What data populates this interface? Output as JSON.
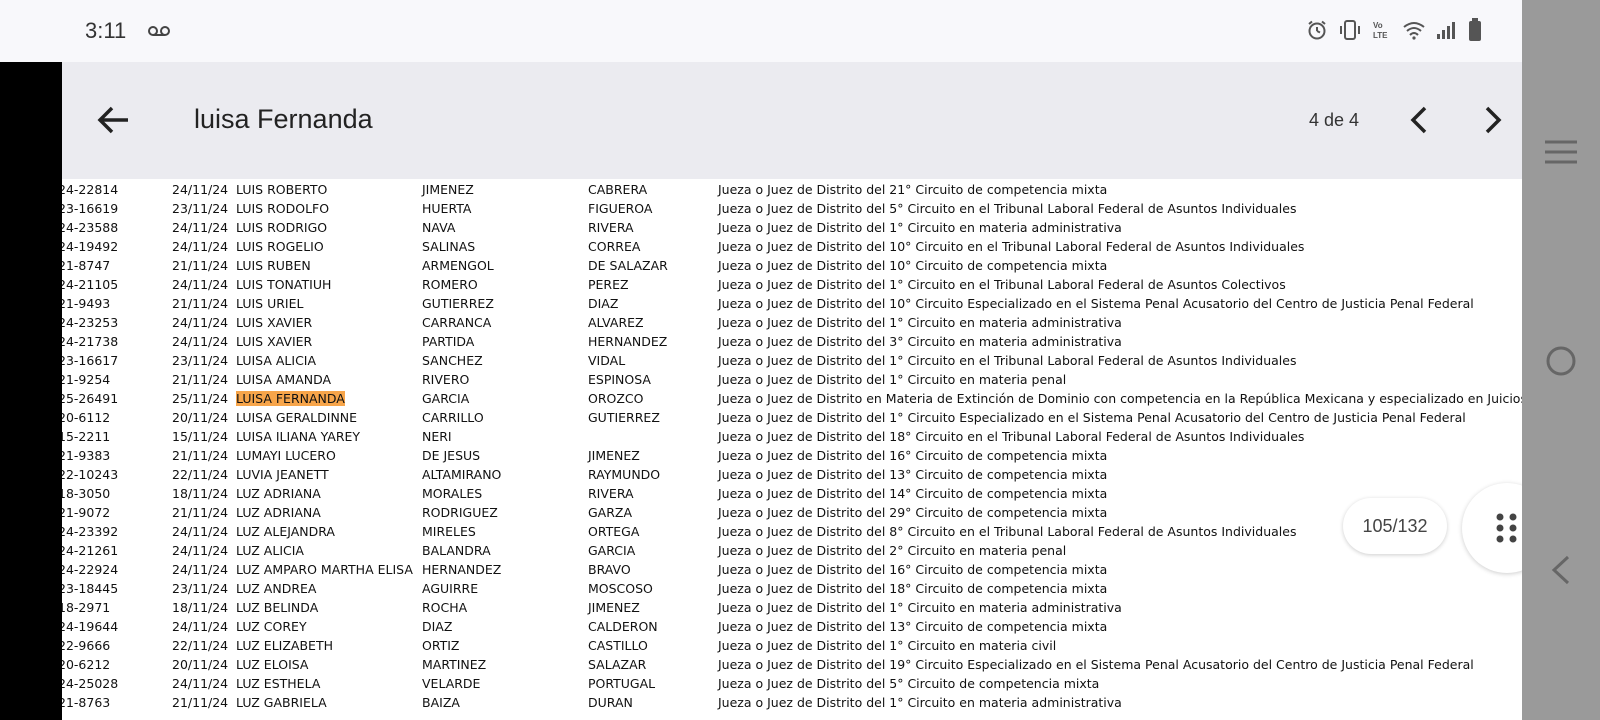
{
  "status_bar": {
    "time": "3:11"
  },
  "search": {
    "query": "luisa Fernanda",
    "match_count": "4 de 4"
  },
  "page_indicator": "105/132",
  "icons": {
    "back": "arrow-left-icon",
    "prev": "chevron-left-icon",
    "next": "chevron-right-icon",
    "menu": "hamburger-menu-icon",
    "home": "circle-home-icon",
    "nav_back": "triangle-back-icon",
    "grid": "grid-dots-icon"
  },
  "colors": {
    "highlight": "#f7a54a",
    "search_bar_bg": "#ebebf0",
    "right_panel": "#9a9a9a"
  },
  "rows": [
    {
      "id": "24-22814",
      "date": "24/11/24",
      "name": "LUIS ROBERTO",
      "ap1": "JIMENEZ",
      "ap2": "CABRERA",
      "desc": "Jueza o Juez de Distrito del 21° Circuito de competencia mixta"
    },
    {
      "id": "23-16619",
      "date": "23/11/24",
      "name": "LUIS RODOLFO",
      "ap1": "HUERTA",
      "ap2": "FIGUEROA",
      "desc": "Jueza o Juez de Distrito del 5° Circuito en el Tribunal Laboral Federal de Asuntos Individuales"
    },
    {
      "id": "24-23588",
      "date": "24/11/24",
      "name": "LUIS RODRIGO",
      "ap1": "NAVA",
      "ap2": "RIVERA",
      "desc": "Jueza o Juez de Distrito del 1° Circuito en materia administrativa"
    },
    {
      "id": "24-19492",
      "date": "24/11/24",
      "name": "LUIS ROGELIO",
      "ap1": "SALINAS",
      "ap2": "CORREA",
      "desc": "Jueza o Juez de Distrito del 10° Circuito en el Tribunal Laboral Federal de Asuntos Individuales"
    },
    {
      "id": "21-8747",
      "date": "21/11/24",
      "name": "LUIS RUBEN",
      "ap1": "ARMENGOL",
      "ap2": "DE SALAZAR",
      "desc": "Jueza o Juez de Distrito del 10° Circuito de competencia mixta"
    },
    {
      "id": "24-21105",
      "date": "24/11/24",
      "name": "LUIS TONATIUH",
      "ap1": "ROMERO",
      "ap2": "PEREZ",
      "desc": "Jueza o Juez de Distrito del 1° Circuito en el Tribunal Laboral Federal de Asuntos Colectivos"
    },
    {
      "id": "21-9493",
      "date": "21/11/24",
      "name": "LUIS URIEL",
      "ap1": "GUTIERREZ",
      "ap2": "DIAZ",
      "desc": "Jueza o Juez de Distrito del 10° Circuito Especializado en el Sistema Penal Acusatorio del Centro de Justicia Penal Federal"
    },
    {
      "id": "24-23253",
      "date": "24/11/24",
      "name": "LUIS XAVIER",
      "ap1": "CARRANCA",
      "ap2": "ALVAREZ",
      "desc": "Jueza o Juez de Distrito del 1° Circuito en materia administrativa"
    },
    {
      "id": "24-21738",
      "date": "24/11/24",
      "name": "LUIS XAVIER",
      "ap1": "PARTIDA",
      "ap2": "HERNANDEZ",
      "desc": "Jueza o Juez de Distrito del 3° Circuito en materia administrativa"
    },
    {
      "id": "23-16617",
      "date": "23/11/24",
      "name": "LUISA ALICIA",
      "ap1": "SANCHEZ",
      "ap2": "VIDAL",
      "desc": "Jueza o Juez de Distrito del 1° Circuito en el Tribunal Laboral Federal de Asuntos Individuales"
    },
    {
      "id": "21-9254",
      "date": "21/11/24",
      "name": "LUISA AMANDA",
      "ap1": "RIVERO",
      "ap2": "ESPINOSA",
      "desc": "Jueza o Juez de Distrito del 1° Circuito en materia penal"
    },
    {
      "id": "25-26491",
      "date": "25/11/24",
      "name": "LUISA FERNANDA",
      "ap1": "GARCIA",
      "ap2": "OROZCO",
      "desc": "Jueza o Juez de Distrito en Materia de Extinción de Dominio con competencia en la República Mexicana y especializado en Juicios",
      "highlight": true
    },
    {
      "id": "20-6112",
      "date": "20/11/24",
      "name": "LUISA GERALDINNE",
      "ap1": "CARRILLO",
      "ap2": "GUTIERREZ",
      "desc": "Jueza o Juez de Distrito del 1° Circuito Especializado en el Sistema Penal Acusatorio del Centro de Justicia Penal Federal"
    },
    {
      "id": "15-2211",
      "date": "15/11/24",
      "name": "LUISA ILIANA YAREY",
      "ap1": "NERI",
      "ap2": "",
      "desc": "Jueza o Juez de Distrito del 18° Circuito en el Tribunal Laboral Federal de Asuntos Individuales"
    },
    {
      "id": "21-9383",
      "date": "21/11/24",
      "name": "LUMAYI LUCERO",
      "ap1": "DE JESUS",
      "ap2": "JIMENEZ",
      "desc": "Jueza o Juez de Distrito del 16° Circuito de competencia mixta"
    },
    {
      "id": "22-10243",
      "date": "22/11/24",
      "name": "LUVIA JEANETT",
      "ap1": "ALTAMIRANO",
      "ap2": "RAYMUNDO",
      "desc": "Jueza o Juez de Distrito del 13° Circuito de competencia mixta"
    },
    {
      "id": "18-3050",
      "date": "18/11/24",
      "name": "LUZ ADRIANA",
      "ap1": "MORALES",
      "ap2": "RIVERA",
      "desc": "Jueza o Juez de Distrito del 14° Circuito de competencia mixta"
    },
    {
      "id": "21-9072",
      "date": "21/11/24",
      "name": "LUZ ADRIANA",
      "ap1": "RODRIGUEZ",
      "ap2": "GARZA",
      "desc": "Jueza o Juez de Distrito del 29° Circuito de competencia mixta"
    },
    {
      "id": "24-23392",
      "date": "24/11/24",
      "name": "LUZ ALEJANDRA",
      "ap1": "MIRELES",
      "ap2": "ORTEGA",
      "desc": "Jueza o Juez de Distrito del 8° Circuito en el Tribunal Laboral Federal de Asuntos Individuales"
    },
    {
      "id": "24-21261",
      "date": "24/11/24",
      "name": "LUZ ALICIA",
      "ap1": "BALANDRA",
      "ap2": "GARCIA",
      "desc": "Jueza o Juez de Distrito del 2° Circuito en materia penal"
    },
    {
      "id": "24-22924",
      "date": "24/11/24",
      "name": "LUZ AMPARO MARTHA ELISA",
      "ap1": "HERNANDEZ",
      "ap2": "BRAVO",
      "desc": "Jueza o Juez de Distrito del 16° Circuito de competencia mixta"
    },
    {
      "id": "23-18445",
      "date": "23/11/24",
      "name": "LUZ ANDREA",
      "ap1": "AGUIRRE",
      "ap2": "MOSCOSO",
      "desc": "Jueza o Juez de Distrito del 18° Circuito de competencia mixta"
    },
    {
      "id": "18-2971",
      "date": "18/11/24",
      "name": "LUZ BELINDA",
      "ap1": "ROCHA",
      "ap2": "JIMENEZ",
      "desc": "Jueza o Juez de Distrito del 1° Circuito en materia administrativa"
    },
    {
      "id": "24-19644",
      "date": "24/11/24",
      "name": "LUZ COREY",
      "ap1": "DIAZ",
      "ap2": "CALDERON",
      "desc": "Jueza o Juez de Distrito del 13° Circuito de competencia mixta"
    },
    {
      "id": "22-9666",
      "date": "22/11/24",
      "name": "LUZ ELIZABETH",
      "ap1": "ORTIZ",
      "ap2": "CASTILLO",
      "desc": "Jueza o Juez de Distrito del 1° Circuito en materia civil"
    },
    {
      "id": "20-6212",
      "date": "20/11/24",
      "name": "LUZ ELOISA",
      "ap1": "MARTINEZ",
      "ap2": "SALAZAR",
      "desc": "Jueza o Juez de Distrito del 19° Circuito Especializado en el Sistema Penal Acusatorio del Centro de Justicia Penal Federal"
    },
    {
      "id": "24-25028",
      "date": "24/11/24",
      "name": "LUZ ESTHELA",
      "ap1": "VELARDE",
      "ap2": "PORTUGAL",
      "desc": "Jueza o Juez de Distrito del 5° Circuito de competencia mixta"
    },
    {
      "id": "21-8763",
      "date": "21/11/24",
      "name": "LUZ GABRIELA",
      "ap1": "BAIZA",
      "ap2": "DURAN",
      "desc": "Jueza o Juez de Distrito del 1° Circuito en materia administrativa"
    }
  ]
}
